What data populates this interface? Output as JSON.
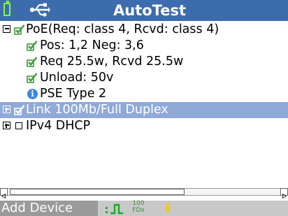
{
  "header": {
    "title": "AutoTest",
    "battery_icon": "battery-icon",
    "connection_icon": "usb-icon"
  },
  "tree": [
    {
      "label": "PoE(Req: class 4, Rcvd: class 4)",
      "expander": "minus",
      "status": "checked",
      "indent": 0
    },
    {
      "label": "Pos: 1,2 Neg: 3,6",
      "status": "checked",
      "indent": 1
    },
    {
      "label": "Req 25.5w, Rcvd 25.5w",
      "status": "checked",
      "indent": 1
    },
    {
      "label": "Unload: 50v",
      "status": "checked",
      "indent": 1
    },
    {
      "label": "PSE Type 2",
      "status": "info",
      "indent": 1
    },
    {
      "label": "Link 100Mb/Full Duplex",
      "expander": "plus",
      "status": "checked",
      "indent": 0,
      "selected": true
    },
    {
      "label": "IPv4 DHCP",
      "expander": "plus",
      "status": "unchecked",
      "indent": 0
    }
  ],
  "status_bar": {
    "button_label": "Add Device",
    "link_icon": "link-pulse-icon",
    "speed_top": "100",
    "speed_bottom": "FDx",
    "poe_icon": "lightning-icon"
  },
  "colors": {
    "title_bar": "#3c6cae",
    "selected_row": "#8fa9d9",
    "check_green": "#3d9b3d",
    "battery_green": "#7fff3a",
    "status_bar": "#c8c8c8",
    "add_device_bg": "#9a9a9a",
    "lightning_yellow": "#f5c800"
  }
}
